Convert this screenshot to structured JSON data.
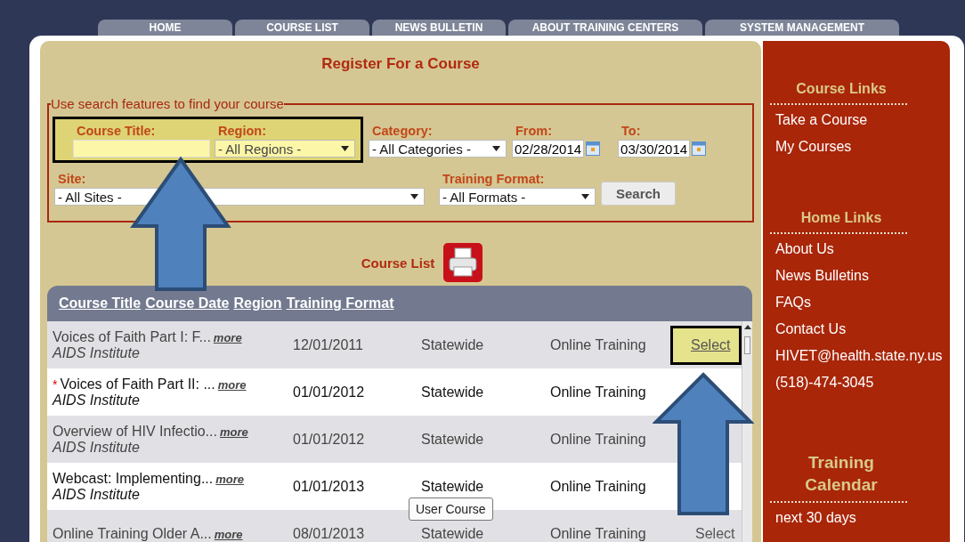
{
  "nav_tabs": [
    {
      "label": "HOME"
    },
    {
      "label": "COURSE LIST"
    },
    {
      "label": "NEWS BULLETIN"
    },
    {
      "label": "ABOUT TRAINING CENTERS"
    },
    {
      "label": "SYSTEM MANAGEMENT"
    }
  ],
  "page_title": "Register For a Course",
  "search": {
    "legend": "Use search features to find your course",
    "rows": [
      {
        "fields": [
          {
            "kind": "text",
            "label": "Course Title:",
            "highlighted": true
          },
          {
            "kind": "select",
            "label": "Region:",
            "value": "- All Regions -",
            "highlighted": true
          },
          {
            "kind": "select",
            "label": "Category:",
            "value": "- All Categories -",
            "highlighted": false
          },
          {
            "kind": "date",
            "label": "From:",
            "value": "02/28/2014",
            "highlighted": false
          },
          {
            "kind": "date",
            "label": "To:",
            "value": "03/30/2014",
            "highlighted": false
          }
        ]
      },
      {
        "fields": [
          {
            "kind": "select",
            "label": "Site:",
            "value": "- All Sites -",
            "highlighted": false
          },
          {
            "kind": "select",
            "label": "Training Format:",
            "value": "- All Formats -",
            "highlighted": false
          }
        ]
      }
    ],
    "button": "Search"
  },
  "course_list": {
    "title": "Course List",
    "columns": [
      "Course Title",
      "Course Date",
      "Region",
      "Training Format"
    ],
    "rows": [
      {
        "title": "Voices of Faith Part I: F...",
        "more": "more",
        "provider": "AIDS Institute",
        "date": "12/01/2011",
        "region": "Statewide",
        "format": "Online Training",
        "select": {
          "label": "Select",
          "highlighted": true
        }
      },
      {
        "mark": "*",
        "title": "Voices of Faith Part II: ...",
        "more": "more",
        "provider": "AIDS Institute",
        "date": "01/01/2012",
        "region": "Statewide",
        "format": "Online Training"
      },
      {
        "title": "Overview of HIV Infectio...",
        "more": "more",
        "provider": "AIDS Institute",
        "date": "01/01/2012",
        "region": "Statewide",
        "format": "Online Training"
      },
      {
        "title": "Webcast: Implementing...",
        "more": "more",
        "provider": "AIDS Institute",
        "date": "01/01/2013",
        "region": "Statewide",
        "format": "Online Training"
      },
      {
        "title": "Online Training Older A...",
        "more": "more",
        "date": "08/01/2013",
        "region": "Statewide",
        "format": "Online Training",
        "select": {
          "label": "Select",
          "highlighted": false
        }
      }
    ]
  },
  "tooltip": "User Course",
  "sidebar": [
    {
      "heading": "Course Links",
      "links": [
        "Take a Course",
        "My Courses"
      ]
    },
    {
      "heading": "Home Links",
      "links": [
        "About Us",
        "News Bulletins",
        "FAQs",
        "Contact Us",
        "HIVET@health.state.ny.us",
        "(518)-474-3045"
      ]
    },
    {
      "heading": "Training Calendar",
      "large": true,
      "links": [
        "next 30 days"
      ]
    }
  ]
}
